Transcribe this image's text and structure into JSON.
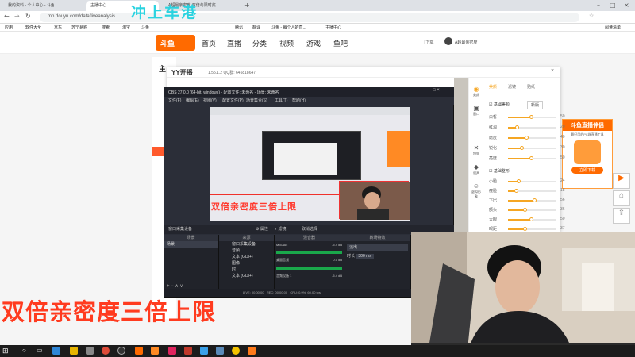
{
  "browser": {
    "tabs": [
      "我的资料 - 个人中心 - 斗鱼",
      "主播中心",
      "A超最亲密度 双倍与限时奖..."
    ],
    "url": "mp.douyu.com/data/liveanalysis",
    "bookmarks": [
      "应用",
      "软件大全",
      "京东",
      "苏宁易购",
      "搜索",
      "淘宝",
      "斗鱼",
      "腾讯",
      "翻译",
      "斗鱼 - 每个人的直...",
      "主播中心",
      "阅读清单"
    ]
  },
  "overlay": {
    "cyan_text": "冲上车港",
    "big_caption": "双倍亲密度三倍上限",
    "obs_caption": "双倍亲密度三倍上限"
  },
  "site": {
    "logo": "斗鱼",
    "logo_sub": "DOUYU.COM",
    "nav": [
      "首页",
      "直播",
      "分类",
      "视频",
      "游戏",
      "鱼吧"
    ],
    "download": "下载",
    "side_label": "主",
    "user": "A超最亲密度"
  },
  "yy": {
    "title": "YY开播",
    "version": "1.55.1.2  QQ群: 645818647",
    "tabs": [
      "美颜",
      "滤镜",
      "贴纸"
    ],
    "beauty_label": "基础美颜",
    "beauty_btn": "新版",
    "reset": "重置",
    "sliders": [
      {
        "label": "白皙",
        "value": "50",
        "fill": 0.5
      },
      {
        "label": "红润",
        "value": "20",
        "fill": 0.2
      },
      {
        "label": "磨皮",
        "value": "40",
        "fill": 0.4
      },
      {
        "label": "锐化",
        "value": "30",
        "fill": 0.3
      },
      {
        "label": "亮度",
        "value": "50",
        "fill": 0.5
      }
    ],
    "shape_label": "基础整形",
    "shape_sliders": [
      {
        "label": "小脸",
        "value": "24",
        "fill": 0.24
      },
      {
        "label": "瘦脸",
        "value": "18",
        "fill": 0.18
      },
      {
        "label": "下巴",
        "value": "56",
        "fill": 0.56
      },
      {
        "label": "额头",
        "value": "36",
        "fill": 0.36
      },
      {
        "label": "大眼",
        "value": "50",
        "fill": 0.5
      },
      {
        "label": "眼距",
        "value": "37",
        "fill": 0.37
      }
    ],
    "icons": [
      "美颜",
      "窗口",
      "特效",
      "道具",
      "虚拟形象"
    ]
  },
  "obs": {
    "title": "OBS 27.0.0 (64-bit, windows) - 配置文件: 未命名 - 场景: 未命名",
    "menu": [
      "文件(F)",
      "编辑(E)",
      "视图(V)",
      "配置文件(P)",
      "场景集合(S)",
      "工具(T)",
      "帮助(H)"
    ],
    "toolbar_source": "窗口采集设备",
    "toolbar_buttons": [
      "属性",
      "滤镜",
      "取消选择"
    ],
    "docks": [
      "场景",
      "来源",
      "混音器",
      "转场特效"
    ],
    "scene": "场景",
    "sources": [
      "窗口采集设备",
      "音频",
      "文本 (GDI+)",
      "图像",
      "时",
      "文本 (GDI+)"
    ],
    "mixer": [
      "Mic/Aux",
      "桌面音频",
      "音频设备 1"
    ],
    "mixer_values": [
      "-5.4 dB",
      "0.0 dB",
      "-5.4 dB"
    ],
    "transition": "淡出",
    "duration_label": "时长",
    "duration": "300 ms",
    "status": [
      "LIVE: 00:00:00",
      "REC: 00:00:00",
      "CPU: 0.9%, 60.00 fps"
    ],
    "status_right": "丢帧: 0 (0.0%)"
  },
  "ad": {
    "title": "斗鱼直播伴侣",
    "sub": "最好用的PC端直播工具",
    "button": "立即下载"
  },
  "colors": {
    "accent": "#ff6a00",
    "caption": "#ff3b1f",
    "cyan": "#2bd3e0",
    "obs_bg": "#2b2e38"
  }
}
